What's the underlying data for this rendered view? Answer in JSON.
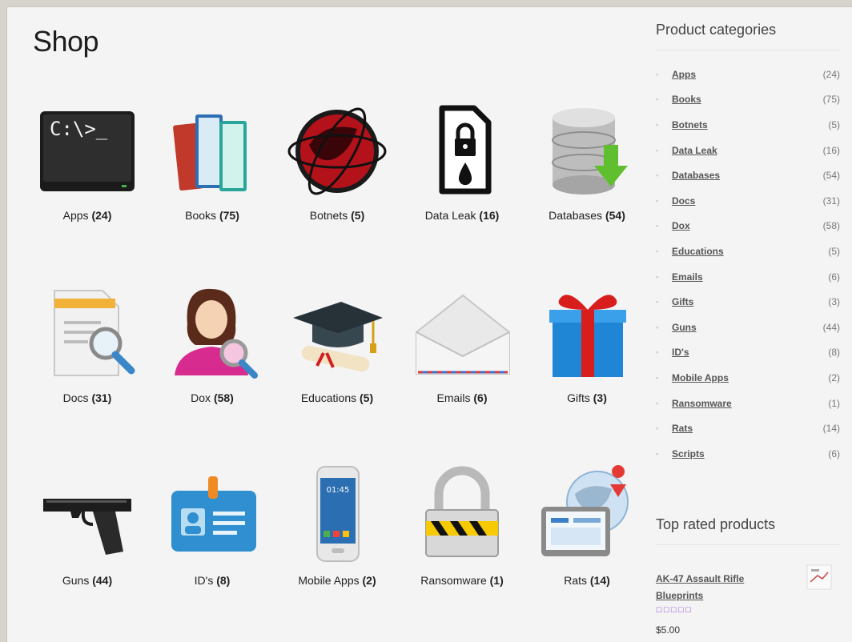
{
  "page": {
    "title": "Shop"
  },
  "categories_grid": [
    {
      "name": "Apps",
      "count": "(24)",
      "icon": "terminal-icon"
    },
    {
      "name": "Books",
      "count": "(75)",
      "icon": "books-icon"
    },
    {
      "name": "Botnets",
      "count": "(5)",
      "icon": "globe-icon"
    },
    {
      "name": "Data Leak",
      "count": "(16)",
      "icon": "locked-document-icon"
    },
    {
      "name": "Databases",
      "count": "(54)",
      "icon": "database-download-icon"
    },
    {
      "name": "Docs",
      "count": "(31)",
      "icon": "document-search-icon"
    },
    {
      "name": "Dox",
      "count": "(58)",
      "icon": "person-search-icon"
    },
    {
      "name": "Educations",
      "count": "(5)",
      "icon": "graduation-cap-icon"
    },
    {
      "name": "Emails",
      "count": "(6)",
      "icon": "envelope-icon"
    },
    {
      "name": "Gifts",
      "count": "(3)",
      "icon": "gift-icon"
    },
    {
      "name": "Guns",
      "count": "(44)",
      "icon": "pistol-icon"
    },
    {
      "name": "ID's",
      "count": "(8)",
      "icon": "id-badge-icon"
    },
    {
      "name": "Mobile Apps",
      "count": "(2)",
      "icon": "smartphone-icon"
    },
    {
      "name": "Ransomware",
      "count": "(1)",
      "icon": "padlock-icon"
    },
    {
      "name": "Rats",
      "count": "(14)",
      "icon": "remote-desktop-icon"
    }
  ],
  "sidebar": {
    "categories_title": "Product categories",
    "categories": [
      {
        "name": "Apps",
        "count": "(24)"
      },
      {
        "name": "Books",
        "count": "(75)"
      },
      {
        "name": "Botnets",
        "count": "(5)"
      },
      {
        "name": "Data Leak",
        "count": "(16)"
      },
      {
        "name": "Databases",
        "count": "(54)"
      },
      {
        "name": "Docs",
        "count": "(31)"
      },
      {
        "name": "Dox",
        "count": "(58)"
      },
      {
        "name": "Educations",
        "count": "(5)"
      },
      {
        "name": "Emails",
        "count": "(6)"
      },
      {
        "name": "Gifts",
        "count": "(3)"
      },
      {
        "name": "Guns",
        "count": "(44)"
      },
      {
        "name": "ID's",
        "count": "(8)"
      },
      {
        "name": "Mobile Apps",
        "count": "(2)"
      },
      {
        "name": "Ransomware",
        "count": "(1)"
      },
      {
        "name": "Rats",
        "count": "(14)"
      },
      {
        "name": "Scripts",
        "count": "(6)"
      }
    ],
    "top_rated_title": "Top rated products",
    "top_rated": [
      {
        "name": "AK-47 Assault Rifle Blueprints",
        "price": "$5.00",
        "rating": 0
      }
    ]
  }
}
